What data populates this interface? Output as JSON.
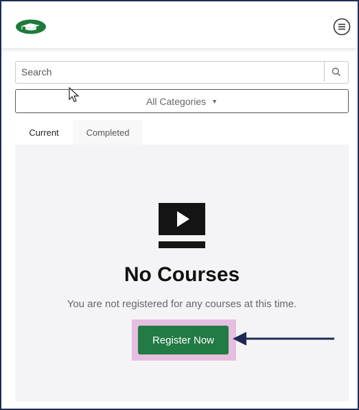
{
  "header": {
    "logo_icon": "graduation-cap-logo",
    "menu_icon": "hamburger-menu-icon",
    "brand_color": "#1e7a3c"
  },
  "search": {
    "placeholder": "Search",
    "value": "",
    "icon": "search-icon"
  },
  "category_filter": {
    "selected": "All Categories",
    "caret": "▼"
  },
  "tabs": [
    {
      "label": "Current",
      "active": true
    },
    {
      "label": "Completed",
      "active": false
    }
  ],
  "empty_state": {
    "icon": "video-play-icon",
    "title": "No Courses",
    "message": "You are not registered for any courses at this time.",
    "button_label": "Register Now",
    "button_color": "#227a44"
  },
  "annotation": {
    "highlight_color": "#e6bfe0",
    "arrow_color": "#1e2a55"
  }
}
